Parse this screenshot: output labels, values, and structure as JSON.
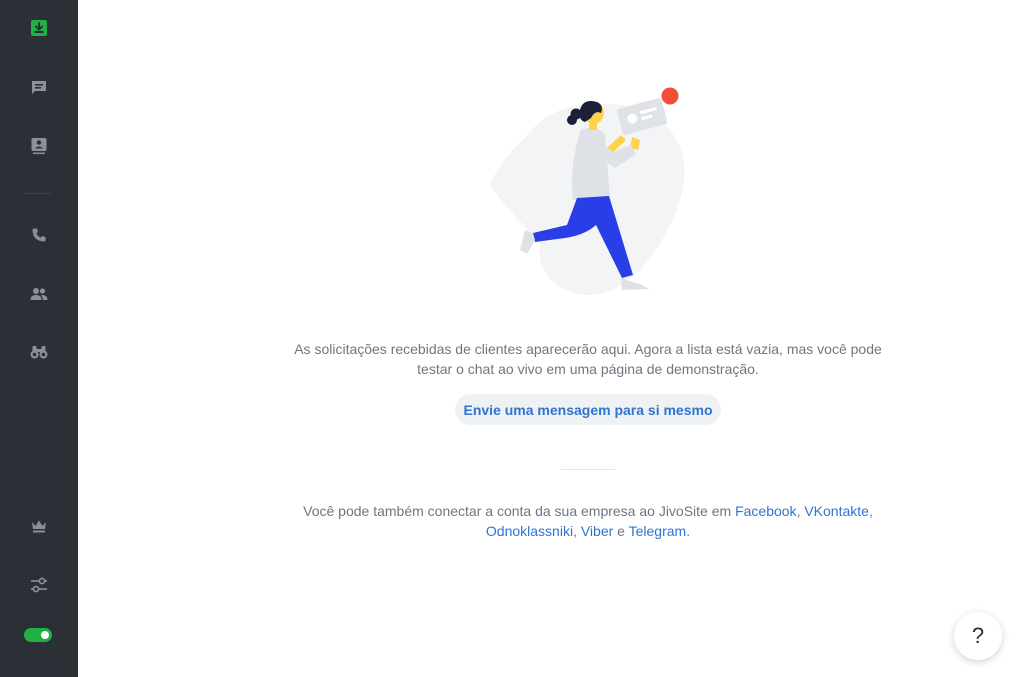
{
  "colors": {
    "sidebar_bg": "#2b2f36",
    "sidebar_icon": "#8a9099",
    "accent_green": "#1fb141",
    "link_blue": "#2f74d0",
    "text_gray": "#6f7681"
  },
  "sidebar": {
    "items": [
      {
        "icon": "inbox-download-icon",
        "active": true
      },
      {
        "icon": "chat-icon",
        "active": false
      },
      {
        "icon": "contacts-icon",
        "active": false
      },
      {
        "icon": "phone-icon",
        "active": false
      },
      {
        "icon": "team-icon",
        "active": false
      },
      {
        "icon": "binoculars-icon",
        "active": false
      },
      {
        "icon": "crown-icon",
        "active": false
      },
      {
        "icon": "settings-sliders-icon",
        "active": false
      }
    ],
    "status_toggle": {
      "on": true
    }
  },
  "main": {
    "empty_message": "As solicitações recebidas de clientes aparecerão aqui. Agora a lista está vazia, mas você pode testar o chat ao vivo em uma página de demonstração.",
    "cta_label": "Envie uma mensagem para si mesmo",
    "connect": {
      "prefix": "Você pode também conectar a conta da sua empresa ao JivoSite em ",
      "facebook": "Facebook",
      "sep1": ", ",
      "vkontakte": "VKontakte",
      "sep2": ", ",
      "odnoklassniki": "Odnoklassniki",
      "sep3": ", ",
      "viber": "Viber",
      "and": " e ",
      "telegram": "Telegram",
      "suffix": "."
    }
  },
  "help_button": {
    "label": "?"
  }
}
